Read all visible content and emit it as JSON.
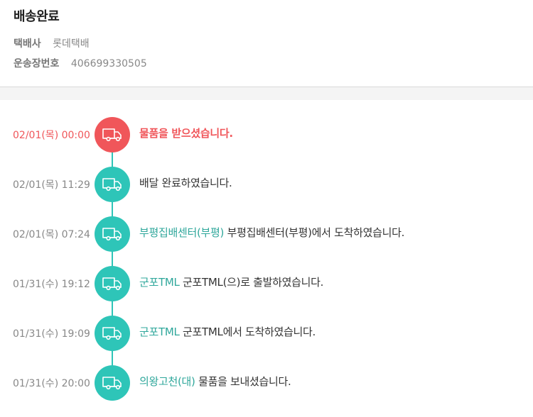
{
  "header": {
    "title": "배송완료",
    "courier_label": "택배사",
    "courier_value": "롯데택배",
    "tracking_label": "운송장번호",
    "tracking_value": "406699330505"
  },
  "colors": {
    "accent": "#2ec5b8",
    "highlight": "#f0565a",
    "location": "#2fa79b"
  },
  "events": [
    {
      "time": "02/01(목) 00:00",
      "location": "",
      "message": "물품을 받으셨습니다.",
      "icon": "truck-icon",
      "highlight": true
    },
    {
      "time": "02/01(목) 11:29",
      "location": "",
      "message": "배달 완료하였습니다.",
      "icon": "truck-icon",
      "highlight": false
    },
    {
      "time": "02/01(목) 07:24",
      "location": "부평집배센터(부평)",
      "message": "부평집배센터(부평)에서 도착하였습니다.",
      "icon": "truck-icon",
      "highlight": false
    },
    {
      "time": "01/31(수) 19:12",
      "location": "군포TML",
      "message": "군포TML(으)로 출발하였습니다.",
      "icon": "truck-icon",
      "highlight": false
    },
    {
      "time": "01/31(수) 19:09",
      "location": "군포TML",
      "message": "군포TML에서 도착하였습니다.",
      "icon": "truck-icon",
      "highlight": false
    },
    {
      "time": "01/31(수) 20:00",
      "location": "의왕고천(대)",
      "message": "물품을 보내셨습니다.",
      "icon": "truck-icon",
      "highlight": false
    }
  ]
}
